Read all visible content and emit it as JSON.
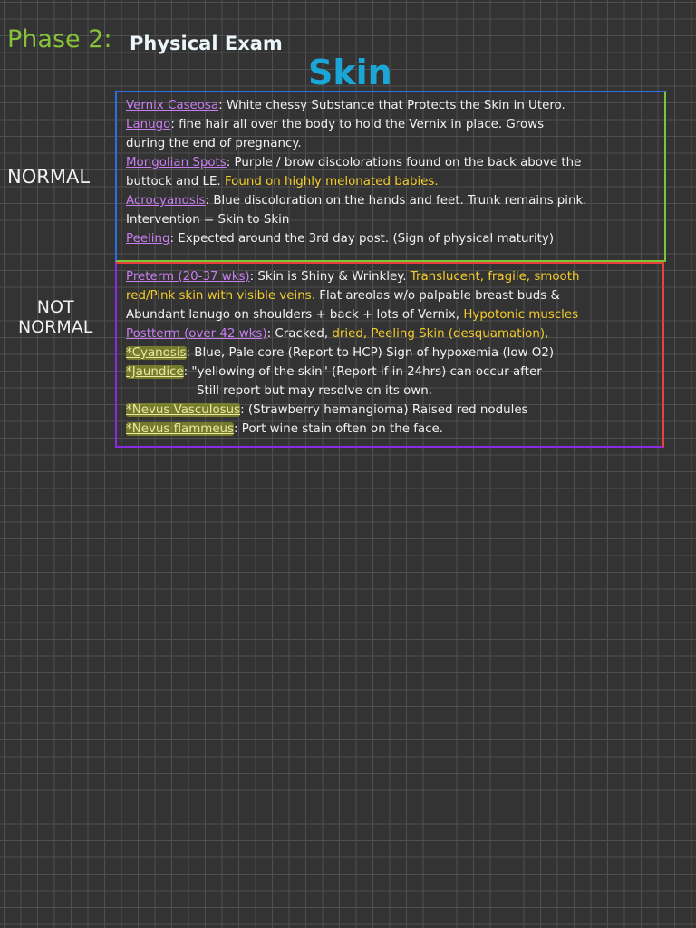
{
  "header": {
    "phase": "Phase 2:",
    "title": "Physical Exam",
    "topic": "Skin"
  },
  "labels": {
    "normal": "NORMAL",
    "not_normal_1": "NOT",
    "not_normal_2": "NORMAL"
  },
  "normal_lines": [
    [
      {
        "t": "Vernix Caseosa",
        "c": "term"
      },
      {
        "t": ": White chessy Substance that Protects the Skin in Utero.",
        "c": ""
      }
    ],
    [
      {
        "t": "Lanugo",
        "c": "term"
      },
      {
        "t": ": fine hair all over the body to hold the Vernix in place. Grows",
        "c": ""
      }
    ],
    [
      {
        "t": "during the end of pregnancy.",
        "c": ""
      }
    ],
    [
      {
        "t": "Mongolian Spots",
        "c": "term"
      },
      {
        "t": ": Purple / brow discolorations found on the back above the",
        "c": ""
      }
    ],
    [
      {
        "t": "buttock and LE. ",
        "c": ""
      },
      {
        "t": "Found on highly melonated babies.",
        "c": "y"
      }
    ],
    [
      {
        "t": "Acrocyanosis",
        "c": "term"
      },
      {
        "t": ": Blue discoloration on the hands and feet. Trunk remains pink.",
        "c": ""
      }
    ],
    [
      {
        "t": "Intervention = Skin to Skin",
        "c": ""
      }
    ],
    [
      {
        "t": "Peeling",
        "c": "term"
      },
      {
        "t": ": Expected around the 3rd day post. (Sign of physical maturity)",
        "c": ""
      }
    ]
  ],
  "not_normal_lines": [
    [
      {
        "t": "Preterm (20-37 wks)",
        "c": "term"
      },
      {
        "t": ": Skin is Shiny & Wrinkley. ",
        "c": ""
      },
      {
        "t": "Translucent, fragile, smooth",
        "c": "y"
      }
    ],
    [
      {
        "t": "red/Pink skin with visible veins.",
        "c": "y"
      },
      {
        "t": " Flat areolas w/o palpable breast buds &",
        "c": ""
      }
    ],
    [
      {
        "t": "Abundant lanugo on shoulders + back + lots of Vernix, ",
        "c": ""
      },
      {
        "t": "Hypotonic muscles",
        "c": "y"
      }
    ],
    [
      {
        "t": "Postterm (over 42 wks)",
        "c": "term"
      },
      {
        "t": ": Cracked, ",
        "c": ""
      },
      {
        "t": "dried, Peeling Skin (desquamation),",
        "c": "y"
      }
    ],
    [
      {
        "t": "*Cyanosis",
        "c": "hl"
      },
      {
        "t": ": Blue, Pale core (Report to HCP) Sign of hypoxemia (low O2)",
        "c": ""
      }
    ],
    [
      {
        "t": "*Jaundice",
        "c": "hl"
      },
      {
        "t": ": \"yellowing of the skin\" (Report if in 24hrs) can occur after",
        "c": ""
      }
    ],
    [
      {
        "t": "Still report but may resolve on its own.",
        "c": "indent"
      }
    ],
    [
      {
        "t": "*Nevus Vasculosus",
        "c": "hl"
      },
      {
        "t": ": (Strawberry hemangioma) Raised red nodules",
        "c": ""
      }
    ],
    [
      {
        "t": "*Nevus flammeus",
        "c": "hl"
      },
      {
        "t": ": Port wine stain often on the face.",
        "c": ""
      }
    ]
  ]
}
